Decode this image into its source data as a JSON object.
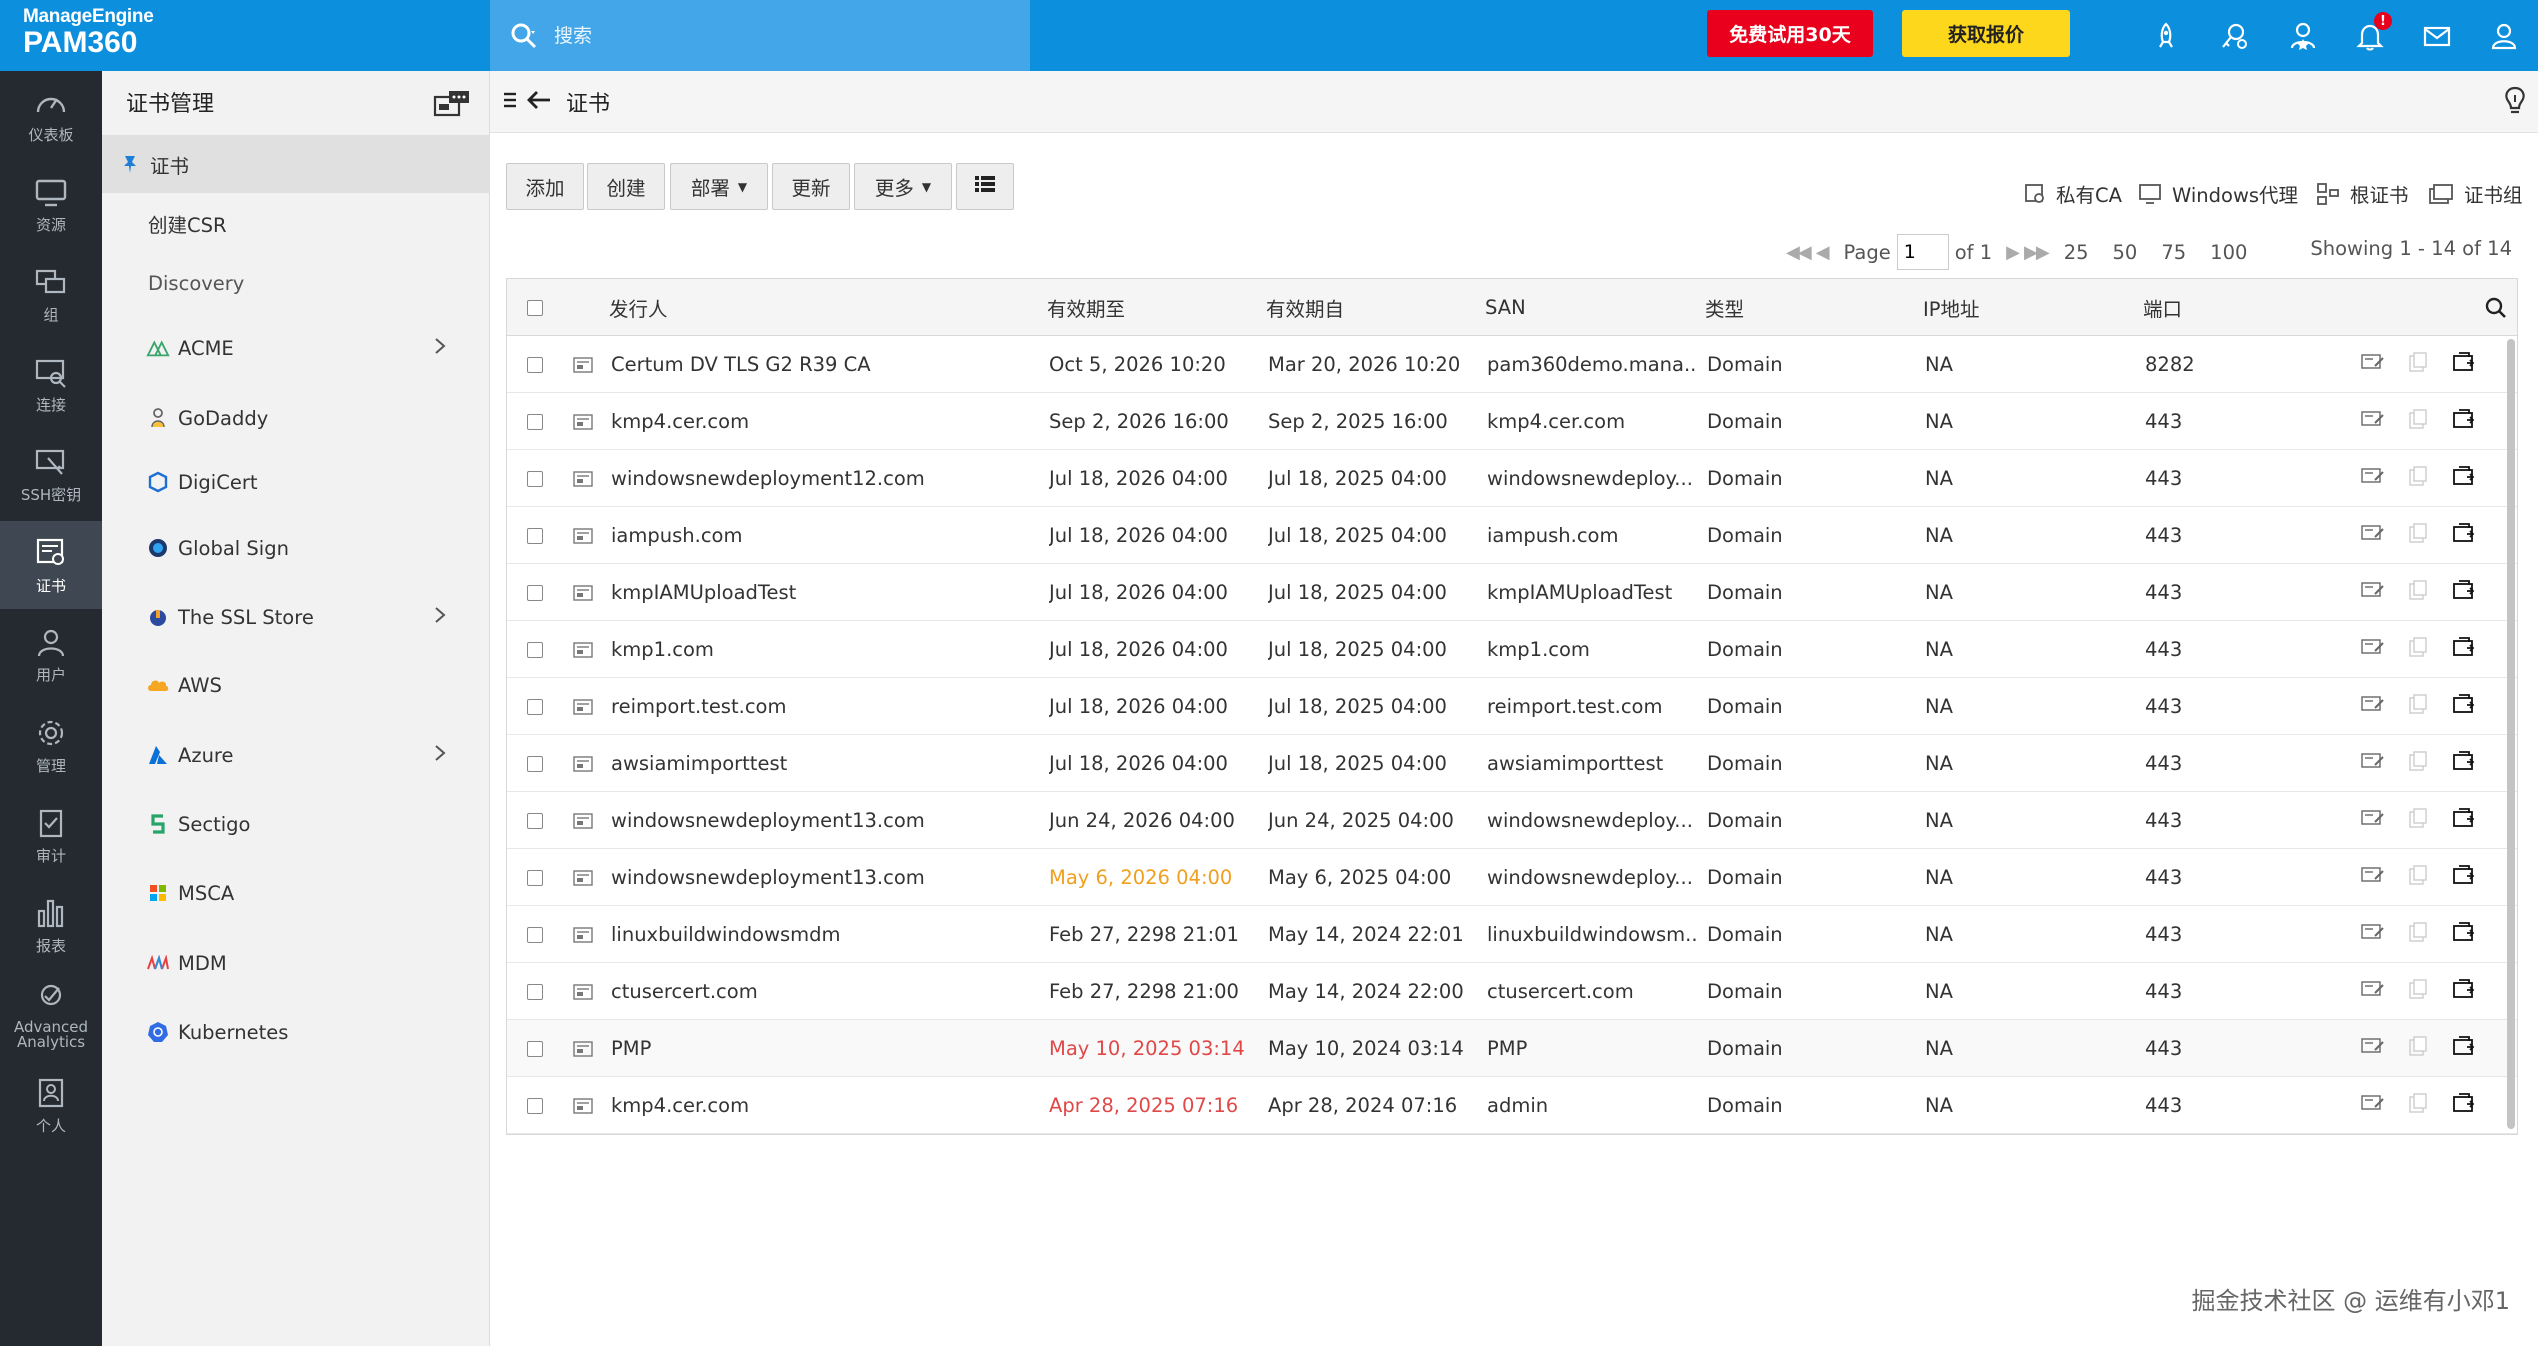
{
  "brand": {
    "line1": "ManageEngine",
    "line2": "PAM360"
  },
  "topbar": {
    "search_placeholder": "搜索",
    "trial_label": "免费试用30天",
    "quote_label": "获取报价",
    "notification_badge": "!",
    "icons": [
      "rocket-icon",
      "cert-link-icon",
      "user-star-icon",
      "bell-icon",
      "mail-icon",
      "user-icon"
    ]
  },
  "leftnav": {
    "items": [
      {
        "label": "仪表板",
        "icon": "dashboard-icon"
      },
      {
        "label": "资源",
        "icon": "monitor-icon"
      },
      {
        "label": "组",
        "icon": "group-icon"
      },
      {
        "label": "连接",
        "icon": "connect-icon"
      },
      {
        "label": "SSH密钥",
        "icon": "ssh-key-icon"
      },
      {
        "label": "证书",
        "icon": "certificate-icon",
        "active": true
      },
      {
        "label": "用户",
        "icon": "user-icon"
      },
      {
        "label": "管理",
        "icon": "gear-icon"
      },
      {
        "label": "审计",
        "icon": "clipboard-icon"
      },
      {
        "label": "报表",
        "icon": "bar-chart-icon"
      },
      {
        "label": "Advanced Analytics",
        "icon": "analytics-icon"
      },
      {
        "label": "个人",
        "icon": "personal-icon"
      }
    ]
  },
  "sidebar": {
    "title": "证书管理",
    "items": [
      {
        "label": "证书",
        "selected": true
      },
      {
        "label": "创建CSR"
      },
      {
        "label": "Discovery"
      },
      {
        "label": "ACME",
        "chevron": true
      },
      {
        "label": "GoDaddy"
      },
      {
        "label": "DigiCert"
      },
      {
        "label": "Global Sign"
      },
      {
        "label": "The SSL Store",
        "chevron": true
      },
      {
        "label": "AWS"
      },
      {
        "label": "Azure",
        "chevron": true
      },
      {
        "label": "Sectigo"
      },
      {
        "label": "MSCA"
      },
      {
        "label": "MDM"
      },
      {
        "label": "Kubernetes"
      }
    ]
  },
  "main": {
    "title": "证书",
    "toolbar": {
      "add": "添加",
      "create": "创建",
      "deploy": "部署",
      "update": "更新",
      "more": "更多"
    },
    "right_links": {
      "private_ca": "私有CA",
      "windows_agent": "Windows代理",
      "root_cert": "根证书",
      "cert_group": "证书组"
    },
    "pager": {
      "page_label": "Page",
      "page_value": "1",
      "of_label": "of 1",
      "sizes": [
        "25",
        "50",
        "75",
        "100"
      ]
    },
    "showing": "Showing 1 - 14 of 14",
    "columns": {
      "issuer": "发行人",
      "valid_to": "有效期至",
      "valid_from": "有效期自",
      "san": "SAN",
      "type": "类型",
      "ip": "IP地址",
      "port": "端口"
    },
    "rows": [
      {
        "issuer": "Certum DV TLS G2 R39 CA",
        "to": "Oct 5, 2026 10:20",
        "from": "Mar 20, 2026 10:20",
        "san": "pam360demo.mana...",
        "type": "Domain",
        "ip": "NA",
        "port": "8282",
        "status": ""
      },
      {
        "issuer": "kmp4.cer.com",
        "to": "Sep 2, 2026 16:00",
        "from": "Sep 2, 2025 16:00",
        "san": "kmp4.cer.com",
        "type": "Domain",
        "ip": "NA",
        "port": "443",
        "status": ""
      },
      {
        "issuer": "windowsnewdeployment12.com",
        "to": "Jul 18, 2026 04:00",
        "from": "Jul 18, 2025 04:00",
        "san": "windowsnewdeploy...",
        "type": "Domain",
        "ip": "NA",
        "port": "443",
        "status": ""
      },
      {
        "issuer": "iampush.com",
        "to": "Jul 18, 2026 04:00",
        "from": "Jul 18, 2025 04:00",
        "san": "iampush.com",
        "type": "Domain",
        "ip": "NA",
        "port": "443",
        "status": ""
      },
      {
        "issuer": "kmpIAMUploadTest",
        "to": "Jul 18, 2026 04:00",
        "from": "Jul 18, 2025 04:00",
        "san": "kmpIAMUploadTest",
        "type": "Domain",
        "ip": "NA",
        "port": "443",
        "status": ""
      },
      {
        "issuer": "kmp1.com",
        "to": "Jul 18, 2026 04:00",
        "from": "Jul 18, 2025 04:00",
        "san": "kmp1.com",
        "type": "Domain",
        "ip": "NA",
        "port": "443",
        "status": ""
      },
      {
        "issuer": "reimport.test.com",
        "to": "Jul 18, 2026 04:00",
        "from": "Jul 18, 2025 04:00",
        "san": "reimport.test.com",
        "type": "Domain",
        "ip": "NA",
        "port": "443",
        "status": ""
      },
      {
        "issuer": "awsiamimporttest",
        "to": "Jul 18, 2026 04:00",
        "from": "Jul 18, 2025 04:00",
        "san": "awsiamimporttest",
        "type": "Domain",
        "ip": "NA",
        "port": "443",
        "status": ""
      },
      {
        "issuer": "windowsnewdeployment13.com",
        "to": "Jun 24, 2026 04:00",
        "from": "Jun 24, 2025 04:00",
        "san": "windowsnewdeploy...",
        "type": "Domain",
        "ip": "NA",
        "port": "443",
        "status": ""
      },
      {
        "issuer": "windowsnewdeployment13.com",
        "to": "May 6, 2026 04:00",
        "from": "May 6, 2025 04:00",
        "san": "windowsnewdeploy...",
        "type": "Domain",
        "ip": "NA",
        "port": "443",
        "status": "warn"
      },
      {
        "issuer": "linuxbuildwindowsmdm",
        "to": "Feb 27, 2298 21:01",
        "from": "May 14, 2024 22:01",
        "san": "linuxbuildwindowsm...",
        "type": "Domain",
        "ip": "NA",
        "port": "443",
        "status": ""
      },
      {
        "issuer": "ctusercert.com",
        "to": "Feb 27, 2298 21:00",
        "from": "May 14, 2024 22:00",
        "san": "ctusercert.com",
        "type": "Domain",
        "ip": "NA",
        "port": "443",
        "status": ""
      },
      {
        "issuer": "PMP",
        "to": "May 10, 2025 03:14",
        "from": "May 10, 2024 03:14",
        "san": "PMP",
        "type": "Domain",
        "ip": "NA",
        "port": "443",
        "status": "expired"
      },
      {
        "issuer": "kmp4.cer.com",
        "to": "Apr 28, 2025 07:16",
        "from": "Apr 28, 2024 07:16",
        "san": "admin",
        "type": "Domain",
        "ip": "NA",
        "port": "443",
        "status": "expired"
      }
    ]
  },
  "watermark": "掘金技术社区 @ 运维有小邓1",
  "colors": {
    "topbar": "#0c8fdd",
    "nav": "#242a30",
    "trial": "#e8001c",
    "quote": "#fdd71c",
    "warn": "#f0a020",
    "expired": "#e04848"
  }
}
